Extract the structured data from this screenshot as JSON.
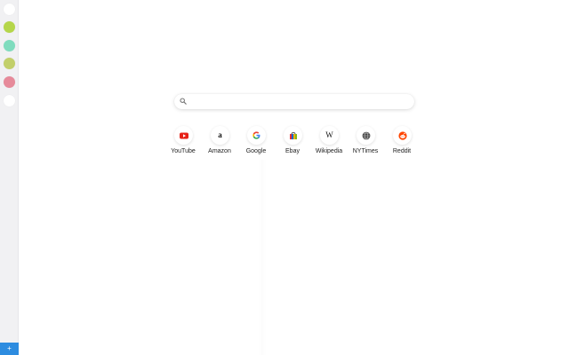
{
  "sidebar": {
    "dots": [
      {
        "color": "#ffffff"
      },
      {
        "color": "#b5d64a"
      },
      {
        "color": "#7fdcbe"
      },
      {
        "color": "#c2cf6a"
      },
      {
        "color": "#e68a9a"
      },
      {
        "color": "#ffffff"
      }
    ],
    "add_label": "+"
  },
  "search": {
    "placeholder": "",
    "value": ""
  },
  "shortcuts": [
    {
      "label": "YouTube",
      "icon": "youtube-icon"
    },
    {
      "label": "Amazon",
      "icon": "amazon-icon"
    },
    {
      "label": "Google",
      "icon": "google-icon"
    },
    {
      "label": "Ebay",
      "icon": "ebay-icon"
    },
    {
      "label": "Wikipedia",
      "icon": "wikipedia-icon"
    },
    {
      "label": "NYTimes",
      "icon": "nytimes-icon"
    },
    {
      "label": "Reddit",
      "icon": "reddit-icon"
    }
  ],
  "colors": {
    "accent": "#2d8ce0",
    "sidebar_bg": "#f1f1f3"
  }
}
